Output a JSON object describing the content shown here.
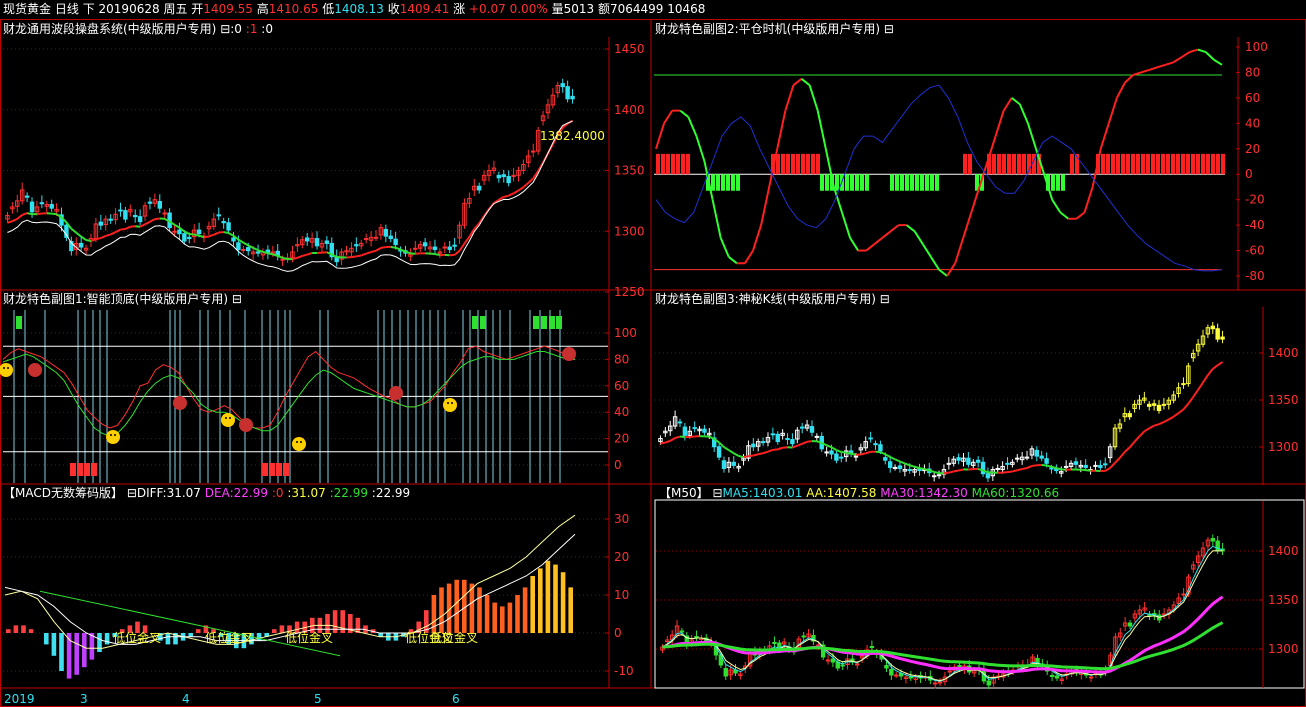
{
  "header": {
    "instrument": "现货黄金",
    "period": "日线",
    "arrow": "下",
    "date": "20190628",
    "weekday": "周五",
    "open_label": "开",
    "open": "1409.55",
    "high_label": "高",
    "high": "1410.65",
    "low_label": "低",
    "low": "1408.13",
    "close_label": "收",
    "close": "1409.41",
    "change_label": "涨",
    "change": "+0.07",
    "change_pct": "0.00%",
    "volume_label": "量",
    "volume": "5013",
    "amount_label": "额",
    "amount": "7064499",
    "extra": "10468"
  },
  "panels": {
    "main": {
      "title": "财龙通用波段操盘系统(中级版用户专用)",
      "toggle": "⊟",
      "v1": ":0",
      "v2": ":1",
      "v3": ":0",
      "annotation": "1382.4000",
      "yticks": [
        "1450",
        "1400",
        "1350",
        "1300",
        "1250"
      ]
    },
    "sub1": {
      "title": "财龙特色副图1:智能顶底(中级版用户专用)",
      "toggle": "⊟",
      "yticks": [
        "100",
        "80",
        "60",
        "40",
        "20",
        "0"
      ]
    },
    "sub2": {
      "title": "财龙特色副图2:平仓时机(中级版用户专用)",
      "toggle": "⊟",
      "yticks": [
        "100",
        "80",
        "60",
        "40",
        "20",
        "0",
        "-20",
        "-40",
        "-60",
        "-80"
      ]
    },
    "sub3": {
      "title": "财龙特色副图3:神秘K线(中级版用户专用)",
      "toggle": "⊟",
      "yticks": [
        "1400",
        "1350",
        "1300"
      ]
    },
    "macd": {
      "title": "【MACD无数筹码版】",
      "toggle": "⊟",
      "diff_label": "DIFF:31.07",
      "dea_label": "DEA:22.99",
      "v0": ":0",
      "v1": ":31.07",
      "v2": ":22.99",
      "v3": ":22.99",
      "annotation": "低位金叉",
      "yticks": [
        "30",
        "20",
        "10",
        "0",
        "-10"
      ]
    },
    "ma": {
      "title": "【M50】",
      "toggle": "⊟",
      "ma5": "MA5:1403.01",
      "aa": "AA:1407.58",
      "ma30": "MA30:1342.30",
      "ma60": "MA60:1320.66",
      "yticks": [
        "1400",
        "1350",
        "1300"
      ]
    }
  },
  "date_axis": [
    "2019",
    "3",
    "4",
    "5",
    "6"
  ],
  "colors": {
    "up": "#ff3030",
    "down": "#30e0f0",
    "grid": "#8b0000",
    "border": "#c00000",
    "ref_line": "#30e030"
  },
  "chart_data": [
    {
      "type": "candlestick",
      "panel": "main",
      "close": [
        1313,
        1320,
        1325,
        1334,
        1328,
        1316,
        1320,
        1323,
        1322,
        1319,
        1318,
        1305,
        1295,
        1284,
        1290,
        1287,
        1286,
        1294,
        1306,
        1305,
        1310,
        1309,
        1314,
        1317,
        1310,
        1318,
        1312,
        1308,
        1321,
        1323,
        1326,
        1319,
        1315,
        1303,
        1300,
        1298,
        1292,
        1294,
        1301,
        1298,
        1296,
        1304,
        1310,
        1313,
        1307,
        1301,
        1292,
        1285,
        1285,
        1284,
        1283,
        1282,
        1283,
        1282,
        1283,
        1280,
        1277,
        1278,
        1283,
        1289,
        1293,
        1292,
        1294,
        1288,
        1290,
        1290,
        1279,
        1275,
        1283,
        1284,
        1286,
        1288,
        1290,
        1294,
        1295,
        1295,
        1303,
        1296,
        1294,
        1289,
        1284,
        1282,
        1281,
        1286,
        1289,
        1288,
        1287,
        1285,
        1283,
        1287,
        1285,
        1288,
        1305,
        1323,
        1327,
        1337,
        1334,
        1346,
        1350,
        1352,
        1344,
        1345,
        1340,
        1346,
        1350,
        1355,
        1362,
        1366,
        1383,
        1395,
        1404,
        1412,
        1420,
        1419,
        1409,
        1409
      ],
      "ylim": [
        1250,
        1460
      ],
      "yticks": [
        1450,
        1400,
        1350,
        1300,
        1250
      ]
    },
    {
      "type": "line",
      "panel": "sub1",
      "series": [
        {
          "values": [
            80,
            85,
            88,
            86,
            84,
            82,
            78,
            74,
            70,
            62,
            52,
            42,
            36,
            31,
            28,
            30,
            38,
            48,
            60,
            62,
            72,
            76,
            74,
            70,
            60,
            50,
            42,
            40,
            42,
            45,
            42,
            36,
            30,
            28,
            28,
            30,
            40,
            52,
            62,
            72,
            82,
            86,
            80,
            74,
            70,
            68,
            66,
            62,
            58,
            55,
            52,
            50,
            46,
            44,
            44,
            46,
            48,
            54,
            60,
            70,
            78,
            88,
            90,
            86,
            84,
            82,
            80,
            82,
            84,
            86,
            88,
            90,
            88,
            86,
            82,
            80
          ]
        },
        {
          "values": [
            78,
            80,
            82,
            84,
            82,
            78,
            74,
            70,
            64,
            54,
            44,
            36,
            28,
            24,
            22,
            24,
            30,
            38,
            48,
            56,
            62,
            66,
            68,
            66,
            60,
            54,
            46,
            42,
            40,
            40,
            38,
            34,
            30,
            28,
            26,
            26,
            30,
            38,
            46,
            54,
            62,
            68,
            72,
            70,
            66,
            62,
            58,
            56,
            54,
            52,
            50,
            48,
            46,
            44,
            44,
            46,
            50,
            56,
            62,
            68,
            74,
            78,
            80,
            82,
            82,
            80,
            80,
            80,
            82,
            84,
            86,
            86,
            84,
            82,
            80,
            80
          ]
        }
      ],
      "ylim": [
        -10,
        110
      ]
    },
    {
      "type": "line",
      "panel": "sub2",
      "series": [
        {
          "values": [
            20,
            40,
            50,
            50,
            45,
            30,
            10,
            -20,
            -50,
            -65,
            -70,
            -70,
            -60,
            -40,
            -10,
            20,
            50,
            70,
            75,
            70,
            50,
            20,
            -10,
            -30,
            -50,
            -60,
            -60,
            -55,
            -50,
            -45,
            -40,
            -40,
            -45,
            -55,
            -65,
            -75,
            -80,
            -70,
            -50,
            -30,
            -10,
            10,
            30,
            50,
            60,
            55,
            40,
            20,
            0,
            -20,
            -30,
            -35,
            -35,
            -30,
            -10,
            20,
            40,
            60,
            72,
            78,
            80,
            82,
            84,
            86,
            88,
            92,
            96,
            98,
            96,
            90,
            86
          ]
        },
        {
          "values": [
            -20,
            -30,
            -35,
            -38,
            -30,
            -10,
            10,
            30,
            40,
            45,
            38,
            20,
            5,
            -10,
            -25,
            -35,
            -40,
            -42,
            -35,
            -20,
            0,
            20,
            30,
            30,
            25,
            35,
            45,
            55,
            62,
            68,
            70,
            60,
            45,
            25,
            10,
            0,
            -10,
            -15,
            -15,
            -5,
            10,
            25,
            30,
            25,
            20,
            10,
            0,
            -10,
            -20,
            -30,
            -40,
            -48,
            -55,
            -60,
            -65,
            -70,
            -72,
            -75,
            -76,
            -76,
            -75
          ]
        }
      ],
      "ylim": [
        -90,
        110
      ]
    },
    {
      "type": "bar",
      "panel": "macd",
      "values": [
        1,
        2,
        2,
        1,
        0,
        -3,
        -6,
        -10,
        -12,
        -11,
        -9,
        -7,
        -5,
        -3,
        -1,
        1,
        2,
        3,
        2,
        0,
        -2,
        -3,
        -3,
        -2,
        -1,
        1,
        2,
        1,
        -1,
        -3,
        -4,
        -4,
        -3,
        -2,
        -1,
        1,
        2,
        2,
        3,
        3,
        4,
        4,
        5,
        6,
        6,
        5,
        4,
        2,
        1,
        -1,
        -2,
        -2,
        -1,
        1,
        3,
        6,
        10,
        12,
        13,
        14,
        14,
        13,
        12,
        10,
        8,
        7,
        8,
        10,
        12,
        15,
        17,
        19,
        18,
        16,
        12
      ],
      "ylim": [
        -14,
        34
      ]
    }
  ]
}
